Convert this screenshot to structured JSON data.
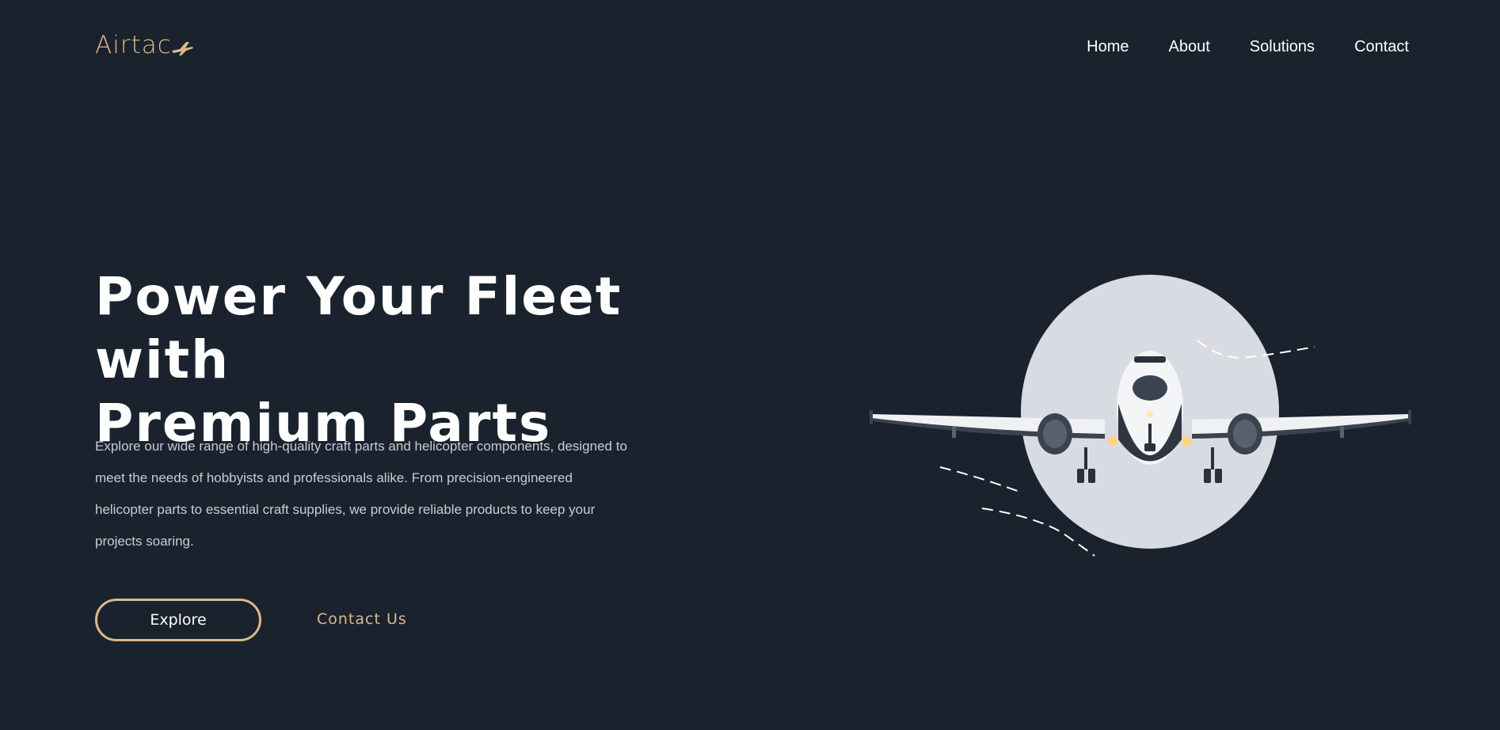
{
  "brand": {
    "name": "Airtac",
    "color": "#dbb98a",
    "icon": "airplane-icon"
  },
  "nav": {
    "items": [
      {
        "label": "Home"
      },
      {
        "label": "About"
      },
      {
        "label": "Solutions"
      },
      {
        "label": "Contact"
      }
    ]
  },
  "hero": {
    "title_line1": "Power Your Fleet with",
    "title_line2": "Premium Parts",
    "description": "Explore our wide range of high-quality craft parts and helicopter components, designed to meet the needs of hobbyists and professionals alike. From precision-engineered helicopter parts to essential craft supplies, we provide reliable products to keep your projects soaring.",
    "explore_label": "Explore",
    "contact_label": "Contact Us",
    "image": "airplane-landing-photo"
  },
  "colors": {
    "background": "#1a222d",
    "accent": "#dbb98a",
    "text": "#ffffff",
    "muted": "#c8cdd3",
    "circle": "#d9dbe2"
  }
}
